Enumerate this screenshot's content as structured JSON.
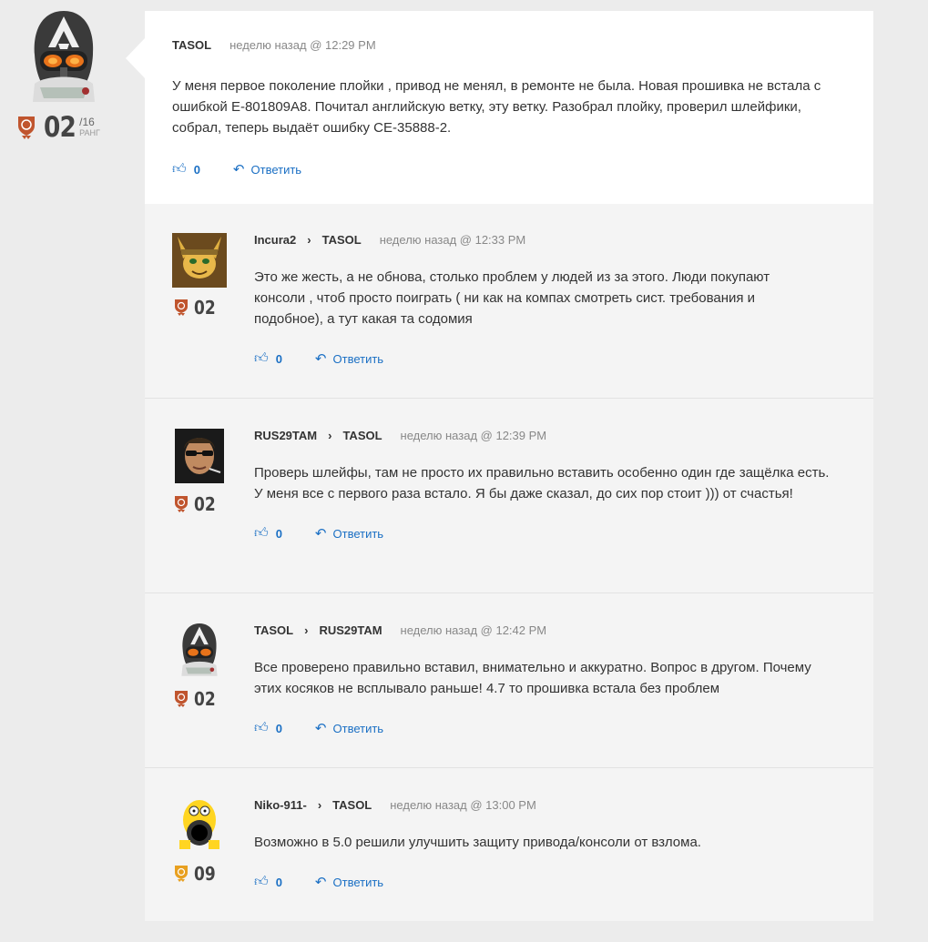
{
  "main": {
    "author": "TASOL",
    "time": "неделю назад @ 12:29 PM",
    "text": "У меня первое поколение плойки , привод не менял, в ремонте не была. Новая прошивка не встала с ошибкой E-801809A8. Почитал английскую ветку, эту ветку. Разобрал плойку, проверил шлейфики, собрал, теперь выдаёт ошибку CE-35888-2.",
    "likes": "0",
    "reply_label": "Ответить",
    "rank": "02",
    "rank_total": "/16",
    "rank_label": "РАНГ"
  },
  "replies": [
    {
      "author": "Incura2",
      "to": "TASOL",
      "time": "неделю назад @ 12:33 PM",
      "text": "Это же жесть, а не обнова, столько проблем у людей из за этого. Люди покупают консоли , чтоб просто поиграть ( ни как на компах смотреть сист. требования и подобное), а тут какая та содомия",
      "likes": "0",
      "reply_label": "Ответить",
      "rank": "02"
    },
    {
      "author": "RUS29TAM",
      "to": "TASOL",
      "time": "неделю назад @ 12:39 PM",
      "text": "Проверь шлейфы, там не просто их правильно вставить особенно один где защёлка есть. У меня все с первого раза встало. Я бы даже сказал, до сих пор стоит ))) от счастья!",
      "likes": "0",
      "reply_label": "Ответить",
      "rank": "02"
    },
    {
      "author": "TASOL",
      "to": "RUS29TAM",
      "time": "неделю назад @ 12:42 PM",
      "text": "Все проверено правильно вставил, внимательно и аккуратно. Вопрос в другом. Почему этих косяков не всплывало раньше! 4.7 то прошивка встала без проблем",
      "likes": "0",
      "reply_label": "Ответить",
      "rank": "02"
    },
    {
      "author": "Niko-911-",
      "to": "TASOL",
      "time": "неделю назад @ 13:00 PM",
      "text": "Возможно в 5.0 решили улучшить защиту привода/консоли от взлома.",
      "likes": "0",
      "reply_label": "Ответить",
      "rank": "09"
    }
  ],
  "colors": {
    "link": "#1a6fc4",
    "bronze": "#c0552e",
    "gold": "#e8a020"
  },
  "icons": {
    "like": "thumbs-up-icon",
    "reply": "reply-arrow-icon",
    "separator": "chevron-right-icon",
    "rank": "trophy-icon"
  }
}
